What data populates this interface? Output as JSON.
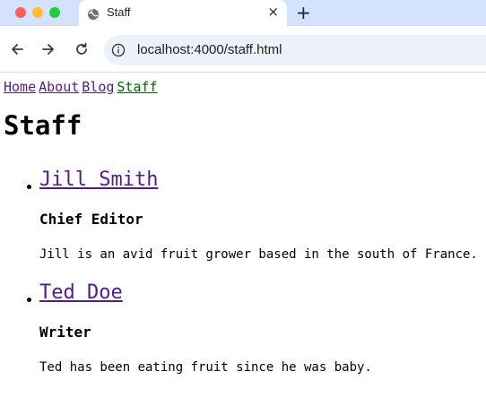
{
  "browser": {
    "tab_title": "Staff",
    "url": "localhost:4000/staff.html",
    "new_tab_label": "+",
    "close_tab_label": "×"
  },
  "nav": {
    "links": [
      "Home",
      "About",
      "Blog",
      "Staff"
    ]
  },
  "page_title": "Staff",
  "staff": [
    {
      "name": "Jill Smith",
      "role": "Chief Editor",
      "bio": "Jill is an avid fruit grower based in the south of France."
    },
    {
      "name": "Ted Doe",
      "role": "Writer",
      "bio": "Ted has been eating fruit since he was baby."
    }
  ],
  "colors": {
    "tabbar": "#d3e3fd",
    "visited_link": "#551a8b",
    "current_link": "#006400"
  }
}
